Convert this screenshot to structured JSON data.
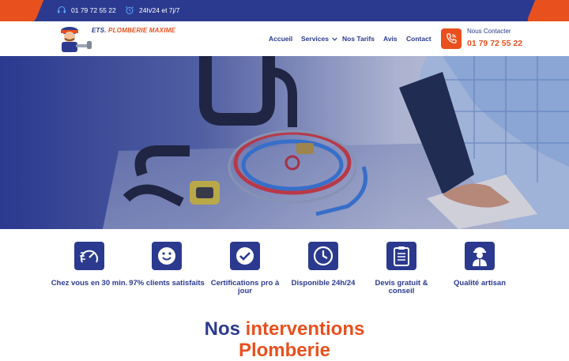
{
  "topbar": {
    "phone": "01 79 72 55 22",
    "hours": "24h/24 et 7j/7"
  },
  "logo": {
    "line1": "ETS.",
    "line2": "PLOMBERIE MAXIME"
  },
  "nav": {
    "items": [
      {
        "label": "Accueil"
      },
      {
        "label": "Services"
      },
      {
        "label": "Nos Tarifs"
      },
      {
        "label": "Avis"
      },
      {
        "label": "Contact"
      }
    ]
  },
  "contact": {
    "label": "Nous Contacter",
    "phone": "01 79 72 55 22"
  },
  "features": [
    {
      "icon": "speedometer-icon",
      "label": "Chez vous en 30 min."
    },
    {
      "icon": "smiley-icon",
      "label": "97% clients satisfaits"
    },
    {
      "icon": "checkmark-icon",
      "label": "Certifications pro à jour"
    },
    {
      "icon": "clock-icon",
      "label": "Disponible 24h/24"
    },
    {
      "icon": "clipboard-icon",
      "label": "Devis gratuit & conseil"
    },
    {
      "icon": "worker-icon",
      "label": "Qualité artisan"
    }
  ],
  "section": {
    "title_part1": "Nos",
    "title_part2": "interventions",
    "title_line2": "Plomberie"
  },
  "colors": {
    "navy": "#2b3a8f",
    "orange": "#e8501e"
  }
}
